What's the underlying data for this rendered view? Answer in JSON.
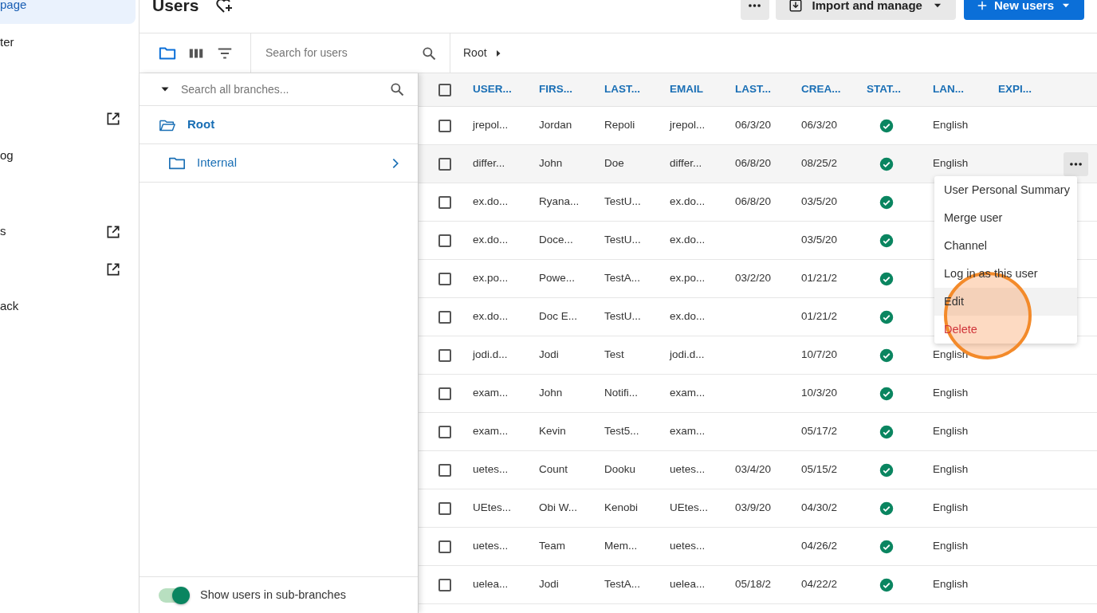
{
  "sidebar": {
    "sections": [
      [
        {
          "label": "page",
          "selected": true
        },
        {
          "label": "ter",
          "selected": false
        }
      ],
      [
        {
          "external": true,
          "selected": false
        },
        {
          "label": "og",
          "selected": false
        }
      ],
      [
        {
          "label": "s",
          "external": true,
          "selected": false
        },
        {
          "external": true,
          "selected": false
        },
        {
          "label": "ack",
          "selected": false
        }
      ]
    ]
  },
  "header": {
    "title": "Users",
    "import_button": "Import and manage",
    "new_button": "New users"
  },
  "toolbar": {
    "tools": [
      {
        "kind": "folder",
        "selected": true
      },
      {
        "kind": "columns",
        "selected": false
      },
      {
        "kind": "filter",
        "selected": false
      }
    ],
    "search": {
      "placeholder": "Search for users"
    },
    "breadcrumb": [
      "Root"
    ]
  },
  "branch_panel": {
    "search": {
      "placeholder": "Search all branches..."
    },
    "tree": [
      {
        "label": "Root",
        "selected": true,
        "expanded": true,
        "children": [
          {
            "label": "Internal",
            "selected": false,
            "expanded": false
          }
        ]
      }
    ],
    "toggle": {
      "label": "Show users in sub-branches",
      "on": true
    }
  },
  "table": {
    "select_all": {
      "checked": false
    },
    "columns": [
      "USER...",
      "FIRS...",
      "LAST...",
      "EMAIL",
      "LAST...",
      "CREA...",
      "STAT...",
      "LAN...",
      "EXPI..."
    ],
    "rows": [
      {
        "cells": [
          "jrepol...",
          "Jordan",
          "Repoli",
          "jrepol...",
          "06/3/20",
          "06/3/20"
        ],
        "active": true,
        "language": "English",
        "checked": false,
        "hovered": false
      },
      {
        "cells": [
          "differ...",
          "John",
          "Doe",
          "differ...",
          "06/8/20",
          "08/25/2"
        ],
        "active": true,
        "language": "English",
        "checked": false,
        "hovered": true,
        "menu": [
          {
            "label": "User Personal Summary",
            "kind": "normal",
            "hovered": false,
            "clicked": false
          },
          {
            "label": "Merge user",
            "kind": "normal",
            "hovered": false,
            "clicked": false
          },
          {
            "label": "Channel",
            "kind": "normal",
            "hovered": false,
            "clicked": false
          },
          {
            "label": "Log in as this user",
            "kind": "normal",
            "hovered": false,
            "clicked": false
          },
          {
            "label": "Edit",
            "kind": "normal",
            "hovered": true,
            "clicked": true
          },
          {
            "label": "Delete",
            "kind": "danger",
            "hovered": false,
            "clicked": false
          }
        ]
      },
      {
        "cells": [
          "ex.do...",
          "Ryana...",
          "TestU...",
          "ex.do...",
          "06/8/20",
          "03/5/20"
        ],
        "active": true,
        "checked": false,
        "hovered": false
      },
      {
        "cells": [
          "ex.do...",
          "Doce...",
          "TestU...",
          "ex.do...",
          "",
          "03/5/20"
        ],
        "active": true,
        "checked": false,
        "hovered": false
      },
      {
        "cells": [
          "ex.po...",
          "Powe...",
          "TestA...",
          "ex.po...",
          "03/2/20",
          "01/21/2"
        ],
        "active": true,
        "checked": false,
        "hovered": false
      },
      {
        "cells": [
          "ex.do...",
          "Doc E...",
          "TestU...",
          "ex.do...",
          "",
          "01/21/2"
        ],
        "active": true,
        "checked": false,
        "hovered": false
      },
      {
        "cells": [
          "jodi.d...",
          "Jodi",
          "Test",
          "jodi.d...",
          "",
          "10/7/20"
        ],
        "active": true,
        "language": "English",
        "checked": false,
        "hovered": false
      },
      {
        "cells": [
          "exam...",
          "John",
          "Notifi...",
          "exam...",
          "",
          "10/3/20"
        ],
        "active": true,
        "language": "English",
        "checked": false,
        "hovered": false
      },
      {
        "cells": [
          "exam...",
          "Kevin",
          "Test5...",
          "exam...",
          "",
          "05/17/2"
        ],
        "active": true,
        "language": "English",
        "checked": false,
        "hovered": false
      },
      {
        "cells": [
          "uetes...",
          "Count",
          "Dooku",
          "uetes...",
          "03/4/20",
          "05/15/2"
        ],
        "active": true,
        "language": "English",
        "checked": false,
        "hovered": false
      },
      {
        "cells": [
          "UEtes...",
          "Obi W...",
          "Kenobi",
          "UEtes...",
          "03/9/20",
          "04/30/2"
        ],
        "active": true,
        "language": "English",
        "checked": false,
        "hovered": false
      },
      {
        "cells": [
          "uetes...",
          "Team",
          "Mem...",
          "uetes...",
          "",
          "04/26/2"
        ],
        "active": true,
        "language": "English",
        "checked": false,
        "hovered": false
      },
      {
        "cells": [
          "uelea...",
          "Jodi",
          "TestA...",
          "uelea...",
          "05/18/2",
          "04/22/2"
        ],
        "active": true,
        "language": "English",
        "checked": false,
        "hovered": false
      }
    ]
  }
}
